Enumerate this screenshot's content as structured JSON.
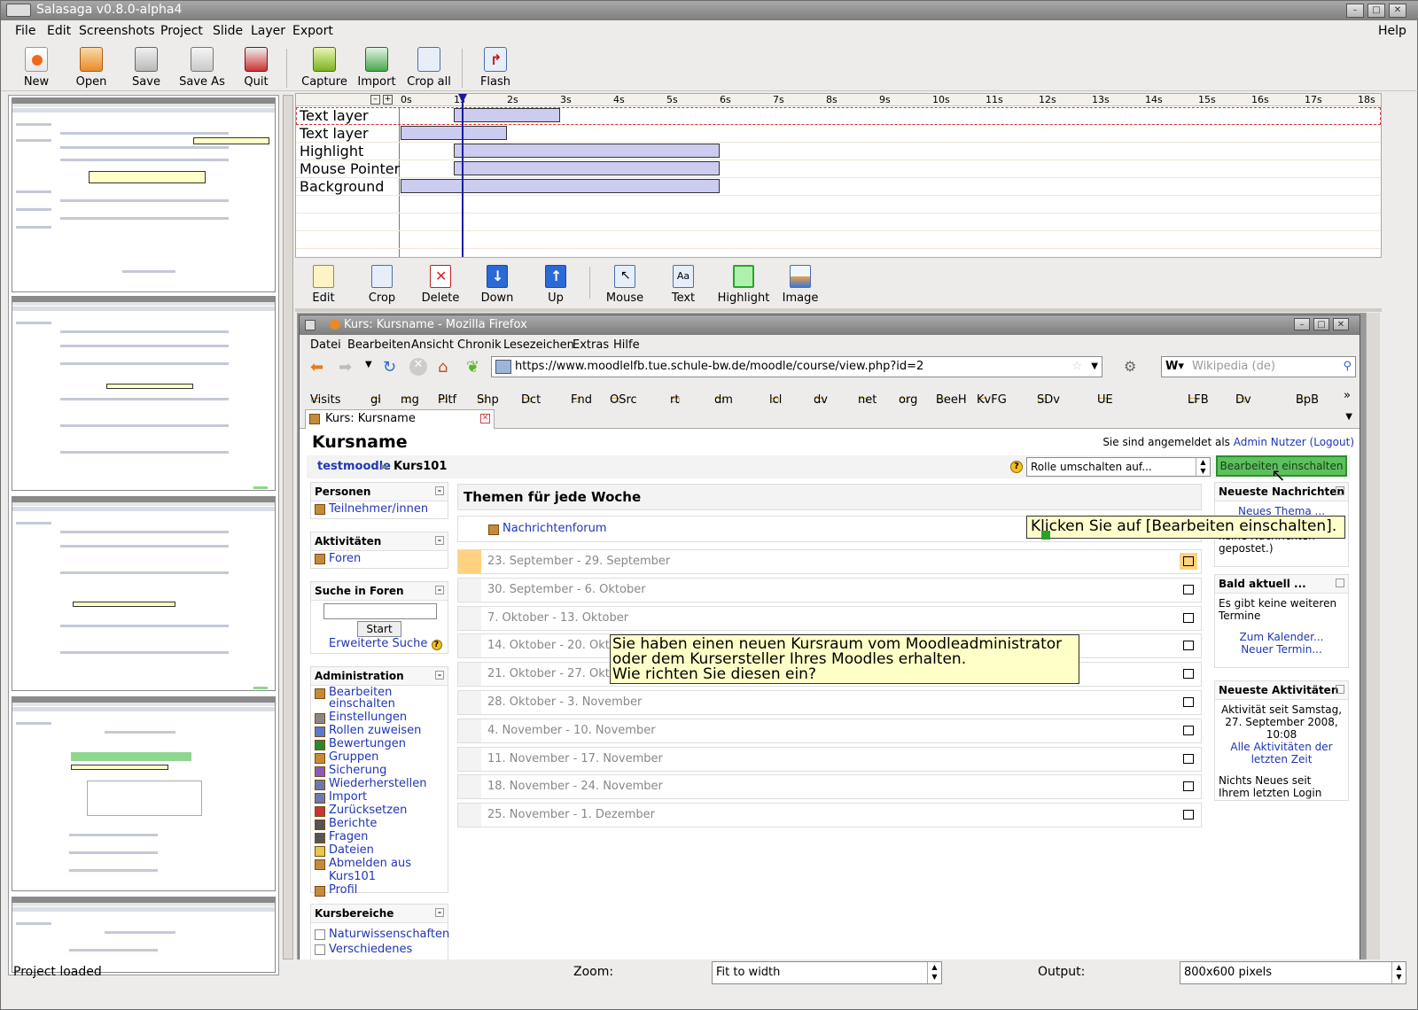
{
  "window": {
    "title": "Salasaga v0.8.0-alpha4"
  },
  "menu": [
    "File",
    "Edit",
    "Screenshots",
    "Project",
    "Slide",
    "Layer",
    "Export"
  ],
  "menu_help": "Help",
  "toolbar": {
    "group1": [
      "New",
      "Open",
      "Save",
      "Save As",
      "Quit"
    ],
    "group2": [
      "Capture",
      "Import",
      "Crop all"
    ],
    "group3": [
      "Flash"
    ]
  },
  "timeline": {
    "ticks": [
      "0s",
      "1s",
      "2s",
      "3s",
      "4s",
      "5s",
      "6s",
      "7s",
      "8s",
      "9s",
      "10s",
      "11s",
      "12s",
      "13s",
      "14s",
      "15s",
      "16s",
      "17s",
      "18s"
    ],
    "cursor_time_s": 1.15,
    "layers": [
      {
        "name": "Text layer",
        "start_s": 1.0,
        "end_s": 3.0
      },
      {
        "name": "Text layer",
        "start_s": 0.0,
        "end_s": 2.0
      },
      {
        "name": "Highlight",
        "start_s": 1.0,
        "end_s": 6.0
      },
      {
        "name": "Mouse Pointer",
        "start_s": 1.0,
        "end_s": 6.0
      },
      {
        "name": "Background",
        "start_s": 0.0,
        "end_s": 6.0
      }
    ]
  },
  "layer_tools": [
    "Edit",
    "Crop",
    "Delete",
    "Down",
    "Up",
    "Mouse",
    "Text",
    "Highlight",
    "Image"
  ],
  "firefox": {
    "title": "Kurs: Kursname - Mozilla Firefox",
    "menu": [
      "Datei",
      "Bearbeiten",
      "Ansicht",
      "Chronik",
      "Lesezeichen",
      "Extras",
      "Hilfe"
    ],
    "url": "https://www.moodlelfb.tue.schule-bw.de/moodle/course/view.php?id=2",
    "search_placeholder": "Wikipedia (de)",
    "bookmarks": [
      "Visits",
      "gl",
      "mg",
      "Pltf",
      "Shp",
      "Dct",
      "Fnd",
      "OSrc",
      "rt",
      "dm",
      "lcl",
      "dv",
      "net",
      "org",
      "BeeH",
      "KvFG",
      "SDv",
      "UE",
      "LFB",
      "Dv",
      "BpB"
    ],
    "tab": "Kurs: Kursname"
  },
  "moodle": {
    "course_title": "Kursname",
    "login_prefix": "Sie sind angemeldet als",
    "login_user": "Admin Nutzer",
    "logout": "(Logout)",
    "breadcrumb_root": "testmoodle",
    "breadcrumb_sep": "►",
    "breadcrumb_course": "Kurs101",
    "role_select": "Rolle umschalten auf...",
    "edit_button": "Bearbeiten einschalten",
    "block_persons": {
      "title": "Personen",
      "items": [
        "Teilnehmer/innen"
      ]
    },
    "block_activities": {
      "title": "Aktivitäten",
      "items": [
        "Foren"
      ]
    },
    "block_search": {
      "title": "Suche in Foren",
      "button": "Start",
      "advanced": "Erweiterte Suche"
    },
    "block_admin": {
      "title": "Administration",
      "items": [
        "Bearbeiten einschalten",
        "Einstellungen",
        "Rollen zuweisen",
        "Bewertungen",
        "Gruppen",
        "Sicherung",
        "Wiederherstellen",
        "Import",
        "Zurücksetzen",
        "Berichte",
        "Fragen",
        "Dateien",
        "Abmelden aus",
        "Kurs101",
        "Profil"
      ]
    },
    "block_categories": {
      "title": "Kursbereiche",
      "items": [
        "Naturwissenschaften",
        "Verschiedenes"
      ]
    },
    "weeks_header": "Themen für jede Woche",
    "forum": "Nachrichtenforum",
    "weeks": [
      "23. September - 29. September",
      "30. September - 6. Oktober",
      "7. Oktober - 13. Oktober",
      "14. Oktober - 20. Oktober",
      "21. Oktober - 27. Oktober",
      "28. Oktober - 3. November",
      "4. November - 10. November",
      "11. November - 17. November",
      "18. November - 24. November",
      "25. November - 1. Dezember"
    ],
    "news": {
      "title": "Neueste Nachrichten",
      "link": "Neues Thema ...",
      "text": "(Es wurden bisher keine Nachrichten gepostet.)"
    },
    "upcoming": {
      "title": "Bald aktuell ...",
      "text": "Es gibt keine weiteren Termine",
      "link1": "Zum Kalender...",
      "link2": "Neuer Termin..."
    },
    "recent": {
      "title": "Neueste Aktivitäten",
      "since": "Aktivität seit Samstag, 27. September 2008, 10:08",
      "link": "Alle Aktivitäten der letzten Zeit",
      "nothing": "Nichts Neues seit Ihrem letzten Login"
    }
  },
  "callouts": {
    "top": "Klicken Sie auf [Bearbeiten einschalten].",
    "main": [
      "Sie haben einen neuen Kursraum vom Moodleadministrator",
      "oder dem Kursersteller Ihres Moodles erhalten.",
      "Wie richten Sie diesen ein?"
    ]
  },
  "status": {
    "text": "Project loaded",
    "zoom_label": "Zoom:",
    "zoom_value": "Fit to width",
    "output_label": "Output:",
    "output_value": "800x600 pixels"
  },
  "colors": {
    "accent_green": "#5cc05c",
    "link": "#2036b5",
    "bar_fill": "#ccccf0",
    "callout_bg": "#ffffc8"
  }
}
